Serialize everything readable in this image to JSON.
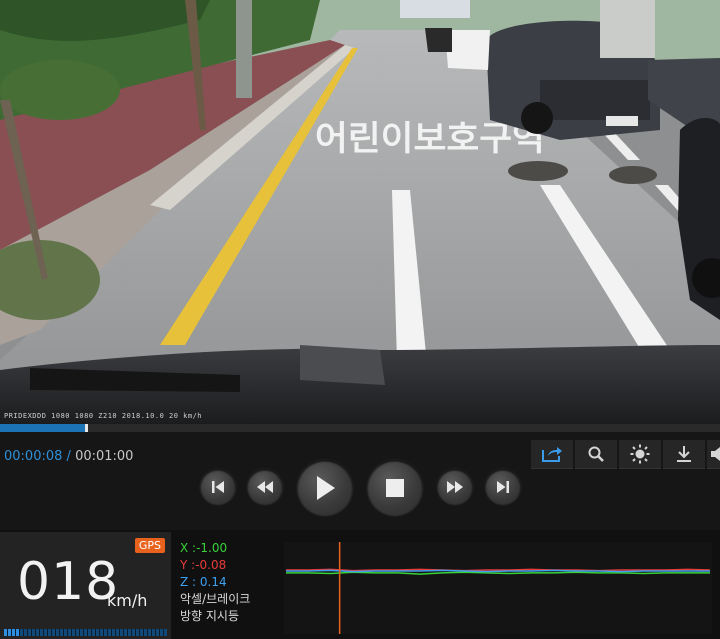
{
  "video": {
    "road_marking_text": "어린이보호구역",
    "overlay_caption": "PRIDEXDDD  1080  1080  Z210  2018.10.0  20 km/h"
  },
  "playback": {
    "progress": 0.12,
    "current_time": "00:00:08",
    "separator": "/",
    "total_time": "00:01:00"
  },
  "toolbar": {
    "icons": [
      "export-icon",
      "zoom-icon",
      "brightness-icon",
      "download-icon",
      "volume-icon"
    ]
  },
  "controls": {
    "buttons": [
      "skip-previous",
      "rewind",
      "play",
      "stop",
      "fast-forward",
      "skip-next"
    ]
  },
  "status": {
    "gps_label": "GPS",
    "speed_value": "018",
    "speed_unit": "km/h",
    "speed_fraction": 0.1,
    "accel_x": "X :-1.00",
    "accel_y": "Y :-0.08",
    "accel_z": "Z : 0.14",
    "accel_brake_label": "악셀/브레이크",
    "turn_signal_label": "방향 지시등",
    "colors": {
      "x": "#38d238",
      "y": "#e83b3b",
      "z": "#3ea0ee",
      "marker": "#e8611d"
    }
  },
  "chart_data": {
    "type": "line",
    "marker_fraction": 0.13,
    "series": [
      {
        "name": "X",
        "values": [
          -1.0,
          -1.0,
          -1.01,
          -0.99,
          -1.0,
          -1.0,
          -1.02,
          -1.0,
          -0.99,
          -1.0,
          -1.01,
          -1.0,
          -1.0,
          -0.99,
          -1.0,
          -1.0,
          -1.01,
          -1.0,
          -1.0,
          -1.0
        ]
      },
      {
        "name": "Y",
        "values": [
          -0.08,
          -0.08,
          -0.07,
          -0.09,
          -0.08,
          -0.08,
          -0.07,
          -0.08,
          -0.09,
          -0.08,
          -0.08,
          -0.07,
          -0.08,
          -0.08,
          -0.09,
          -0.08,
          -0.08,
          -0.08,
          -0.07,
          -0.08
        ]
      },
      {
        "name": "Z",
        "values": [
          0.14,
          0.14,
          0.15,
          0.13,
          0.14,
          0.14,
          0.14,
          0.15,
          0.14,
          0.13,
          0.14,
          0.14,
          0.15,
          0.14,
          0.14,
          0.13,
          0.14,
          0.14,
          0.14,
          0.14
        ]
      }
    ]
  }
}
